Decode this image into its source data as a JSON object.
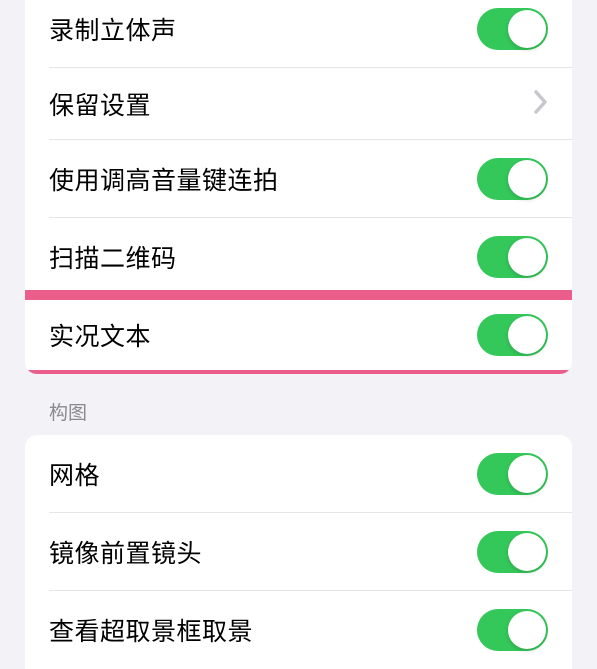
{
  "section1": {
    "row0": {
      "label": "录制立体声",
      "on": true
    },
    "row1": {
      "label": "保留设置"
    },
    "row2": {
      "label": "使用调高音量键连拍",
      "on": true
    },
    "row3": {
      "label": "扫描二维码",
      "on": true
    },
    "row4": {
      "label": "实况文本",
      "on": true
    }
  },
  "section2": {
    "header": "构图",
    "row0": {
      "label": "网格",
      "on": true
    },
    "row1": {
      "label": "镜像前置镜头",
      "on": true
    },
    "row2": {
      "label": "查看超取景框取景",
      "on": true
    }
  }
}
